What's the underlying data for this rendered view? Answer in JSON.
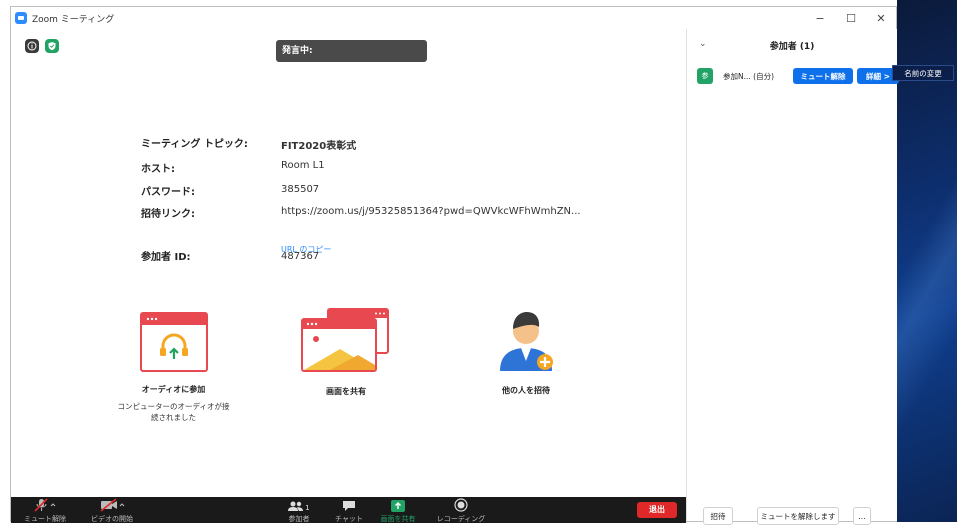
{
  "window": {
    "title": "Zoom ミーティング"
  },
  "speaking": {
    "label": "発言中:"
  },
  "meeting": {
    "topic_label": "ミーティング トピック:",
    "topic": "FIT2020表彰式",
    "host_label": "ホスト:",
    "host": "Room L1",
    "password_label": "パスワード:",
    "password": "385507",
    "invite_label": "招待リンク:",
    "invite_link": "https://zoom.us/j/95325851364?pwd=QWVkcWFhWmhZN...",
    "copy_url": "URL のコピー",
    "participant_id_label": "参加者 ID:",
    "participant_id": "487367"
  },
  "actions": {
    "audio": {
      "label": "オーディオに参加",
      "sub_line1": "コンピューターのオーディオが接",
      "sub_line2": "続されました"
    },
    "share": {
      "label": "画面を共有"
    },
    "invite": {
      "label": "他の人を招待"
    }
  },
  "toolbar": {
    "unmute": "ミュート解除",
    "start_video": "ビデオの開始",
    "participants": "参加者",
    "participants_count": "1",
    "chat": "チャット",
    "share_screen": "画面を共有",
    "record": "レコーディング",
    "leave": "退出"
  },
  "panel": {
    "title": "参加者 (1)",
    "participant": {
      "avatar": "参",
      "name": "参加N... (自分)",
      "unmute_btn": "ミュート解除",
      "more_btn": "詳細 >"
    },
    "footer": {
      "invite": "招待",
      "unmute_all": "ミュートを解除します",
      "more": "..."
    }
  },
  "context_menu": {
    "rename": "名前の変更"
  },
  "colors": {
    "accent": "#0e71eb",
    "leave": "#e02828",
    "share": "#21a366",
    "toolbar": "#1a1a1a"
  }
}
